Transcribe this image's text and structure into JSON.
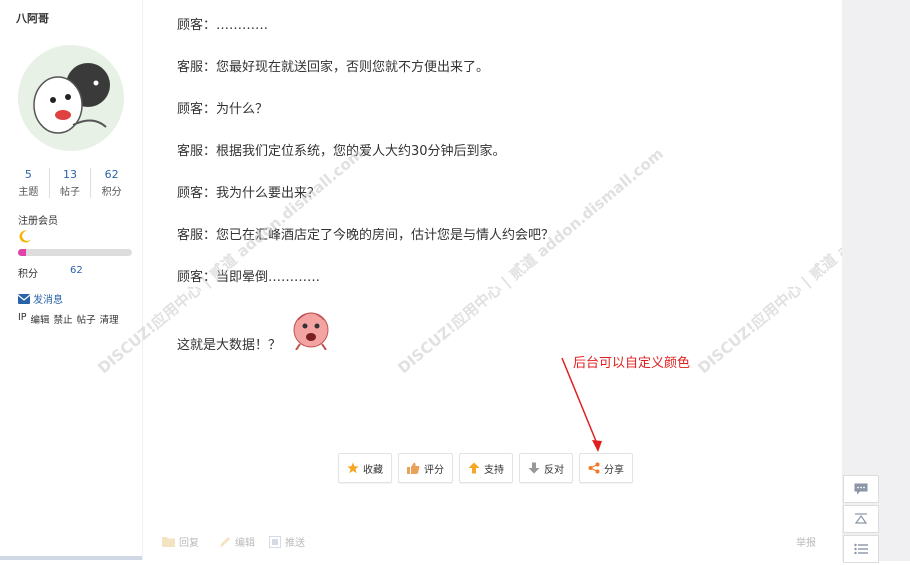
{
  "user": {
    "name": "八阿哥",
    "stats": [
      {
        "num": "5",
        "label": "主题"
      },
      {
        "num": "13",
        "label": "帖子"
      },
      {
        "num": "62",
        "label": "积分"
      }
    ],
    "group": "注册会员",
    "level_fill": 0.07,
    "credits_label": "积分",
    "credits_value": "62",
    "message_link": "发消息",
    "admin_links": [
      "IP",
      "编辑",
      "禁止",
      "帖子",
      "清理"
    ]
  },
  "post": {
    "lines": [
      "顾客：…………",
      "客服：您最好现在就送回家，否则您就不方便出来了。",
      "顾客：为什么？",
      "客服：根据我们定位系统，您的爱人大约30分钟后到家。",
      "顾客：我为什么要出来？",
      "客服：您已在汇峰酒店定了今晚的房间，估计您是与情人约会吧？",
      "顾客：当即晕倒…………",
      "这就是大数据！？"
    ]
  },
  "actions": [
    {
      "label": "收藏",
      "icon": "star-icon",
      "color": "#f5a623"
    },
    {
      "label": "评分",
      "icon": "thumb-icon",
      "color": "#e8a25c"
    },
    {
      "label": "支持",
      "icon": "arrow-up-icon",
      "color": "#f5a623"
    },
    {
      "label": "反对",
      "icon": "arrow-down-icon",
      "color": "#999999"
    },
    {
      "label": "分享",
      "icon": "share-icon",
      "color": "#f07a2a"
    }
  ],
  "annotation": "后台可以自定义颜色",
  "footer": {
    "reply": "回复",
    "edit": "编辑",
    "recommend": "推送",
    "report": "举报"
  },
  "watermark": "DISCUZ!应用中心 | 贰道 addon.dismall.com",
  "colors": {
    "accent": "#2a64a8",
    "annotation": "#e02020"
  }
}
